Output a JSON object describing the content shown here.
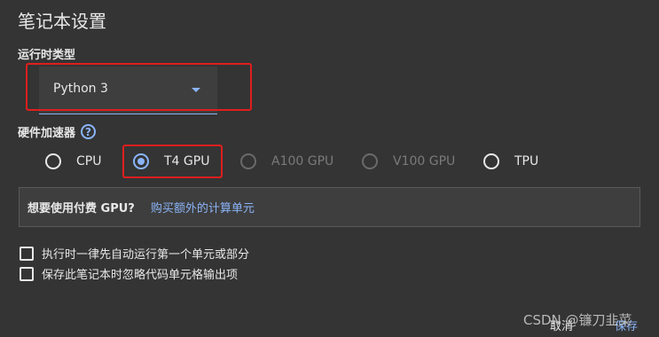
{
  "dialog": {
    "title": "笔记本设置",
    "runtime_type_label": "运行时类型",
    "runtime_type_value": "Python 3",
    "hardware_accelerator_label": "硬件加速器",
    "help_icon_glyph": "?",
    "accelerators": [
      {
        "label": "CPU",
        "selected": false,
        "disabled": false
      },
      {
        "label": "T4 GPU",
        "selected": true,
        "disabled": false
      },
      {
        "label": "A100 GPU",
        "selected": false,
        "disabled": true
      },
      {
        "label": "V100 GPU",
        "selected": false,
        "disabled": true
      },
      {
        "label": "TPU",
        "selected": false,
        "disabled": false
      }
    ],
    "promo": {
      "text": "想要使用付费 GPU?",
      "link": "购买额外的计算单元"
    },
    "options": [
      {
        "label": "执行时一律先自动运行第一个单元或部分",
        "checked": false
      },
      {
        "label": "保存此笔记本时忽略代码单元格输出项",
        "checked": false
      }
    ],
    "cancel_label": "取消",
    "save_label": "保存"
  },
  "watermark": "CSDN @镰刀韭菜",
  "colors": {
    "background": "#343434",
    "accent": "#8ab4f8",
    "highlight_box": "#e01e1e"
  }
}
